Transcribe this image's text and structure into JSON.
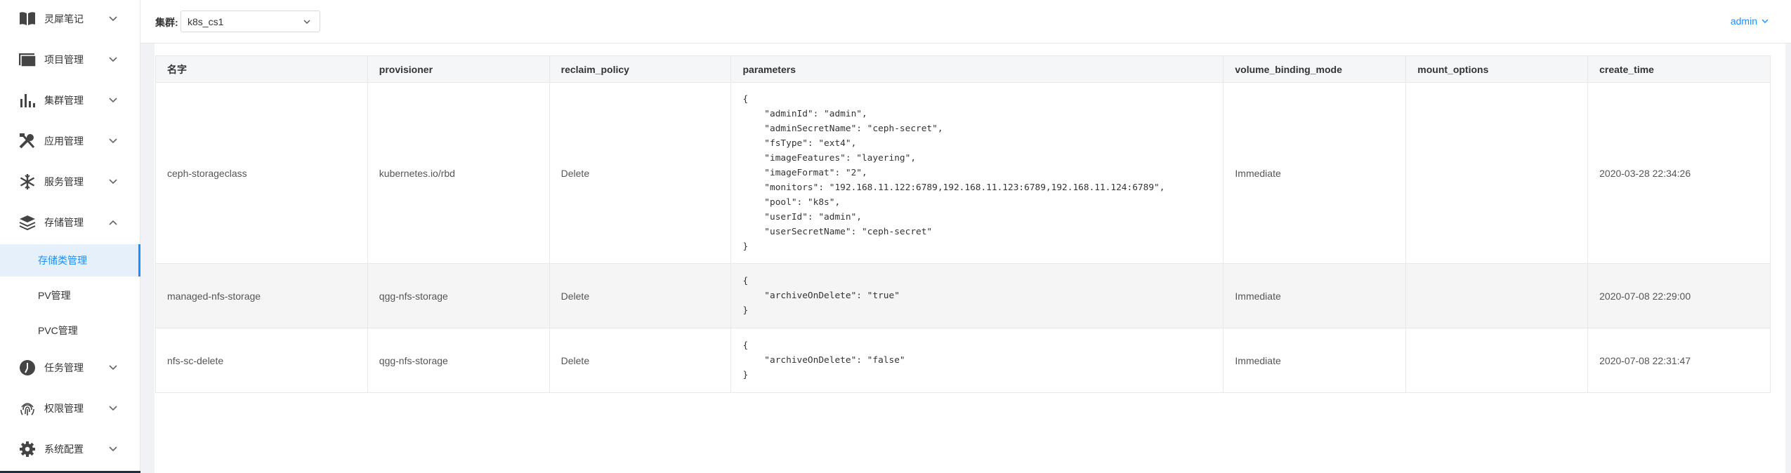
{
  "sidebar": {
    "items": [
      {
        "label": "灵犀笔记",
        "icon": "book-icon",
        "expanded": false
      },
      {
        "label": "项目管理",
        "icon": "folder-icon",
        "expanded": false
      },
      {
        "label": "集群管理",
        "icon": "bar-chart-icon",
        "expanded": false
      },
      {
        "label": "应用管理",
        "icon": "tools-icon",
        "expanded": false
      },
      {
        "label": "服务管理",
        "icon": "snowflake-icon",
        "expanded": false
      },
      {
        "label": "存储管理",
        "icon": "layers-icon",
        "expanded": true,
        "children": [
          {
            "label": "存储类管理",
            "active": true
          },
          {
            "label": "PV管理",
            "active": false
          },
          {
            "label": "PVC管理",
            "active": false
          }
        ]
      },
      {
        "label": "任务管理",
        "icon": "task-icon",
        "expanded": false
      },
      {
        "label": "权限管理",
        "icon": "fingerprint-icon",
        "expanded": false
      },
      {
        "label": "系统配置",
        "icon": "gear-icon",
        "expanded": false
      }
    ]
  },
  "header": {
    "cluster_label": "集群:",
    "cluster_value": "k8s_cs1",
    "user": "admin"
  },
  "table": {
    "columns": [
      "名字",
      "provisioner",
      "reclaim_policy",
      "parameters",
      "volume_binding_mode",
      "mount_options",
      "create_time"
    ],
    "rows": [
      {
        "name": "ceph-storageclass",
        "provisioner": "kubernetes.io/rbd",
        "reclaim_policy": "Delete",
        "parameters": "{\n    \"adminId\": \"admin\",\n    \"adminSecretName\": \"ceph-secret\",\n    \"fsType\": \"ext4\",\n    \"imageFeatures\": \"layering\",\n    \"imageFormat\": \"2\",\n    \"monitors\": \"192.168.11.122:6789,192.168.11.123:6789,192.168.11.124:6789\",\n    \"pool\": \"k8s\",\n    \"userId\": \"admin\",\n    \"userSecretName\": \"ceph-secret\"\n}",
        "volume_binding_mode": "Immediate",
        "mount_options": "",
        "create_time": "2020-03-28 22:34:26"
      },
      {
        "name": "managed-nfs-storage",
        "provisioner": "qgg-nfs-storage",
        "reclaim_policy": "Delete",
        "parameters": "{\n    \"archiveOnDelete\": \"true\"\n}",
        "volume_binding_mode": "Immediate",
        "mount_options": "",
        "create_time": "2020-07-08 22:29:00"
      },
      {
        "name": "nfs-sc-delete",
        "provisioner": "qgg-nfs-storage",
        "reclaim_policy": "Delete",
        "parameters": "{\n    \"archiveOnDelete\": \"false\"\n}",
        "volume_binding_mode": "Immediate",
        "mount_options": "",
        "create_time": "2020-07-08 22:31:47"
      }
    ]
  },
  "colors": {
    "accent": "#1890ff",
    "active_bg": "#e6f0fa",
    "sidebar_bottom": "#1f2d3d"
  }
}
